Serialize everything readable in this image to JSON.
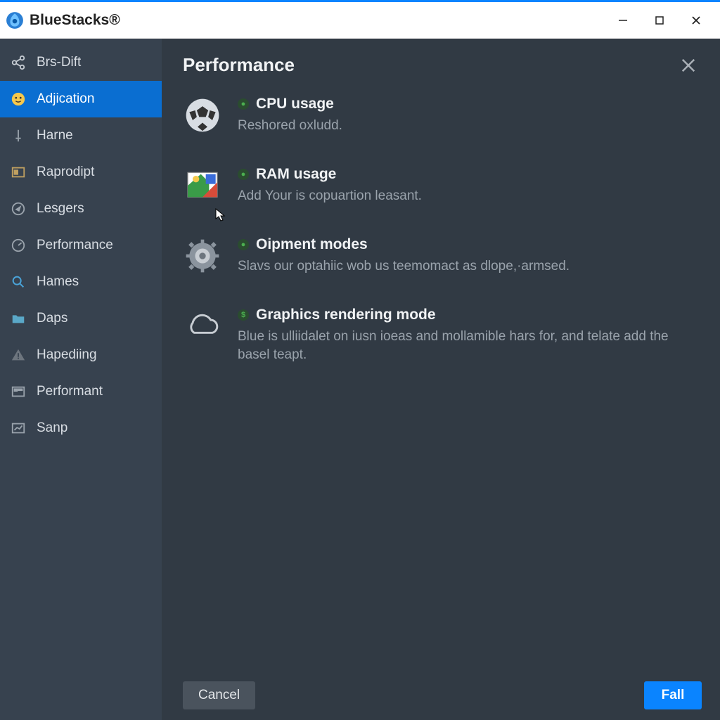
{
  "app": {
    "name": "BlueStacks®"
  },
  "sidebar": {
    "items": [
      {
        "label": "Brs-Dift"
      },
      {
        "label": "Adjication"
      },
      {
        "label": "Harne"
      },
      {
        "label": "Raprodipt"
      },
      {
        "label": "Lesgers"
      },
      {
        "label": "Performance"
      },
      {
        "label": "Hames"
      },
      {
        "label": "Daps"
      },
      {
        "label": "Hapediing"
      },
      {
        "label": "Performant"
      },
      {
        "label": "Sanp"
      }
    ]
  },
  "main": {
    "title": "Performance",
    "settings": [
      {
        "title": "CPU usage",
        "desc": "Reshored oxludd."
      },
      {
        "title": "RAM usage",
        "desc": "Add Your is copuartion leasant."
      },
      {
        "title": "Oipment modes",
        "desc": "Slavs our optahiic wob us teemomact as dlope,·armsed."
      },
      {
        "title": "Graphics rendering mode",
        "desc": "Blue is ulliidalet on iusn ioeas and mollamible hars for, and telate add the basel teapt."
      }
    ]
  },
  "footer": {
    "cancel": "Cancel",
    "confirm": "Fall"
  }
}
